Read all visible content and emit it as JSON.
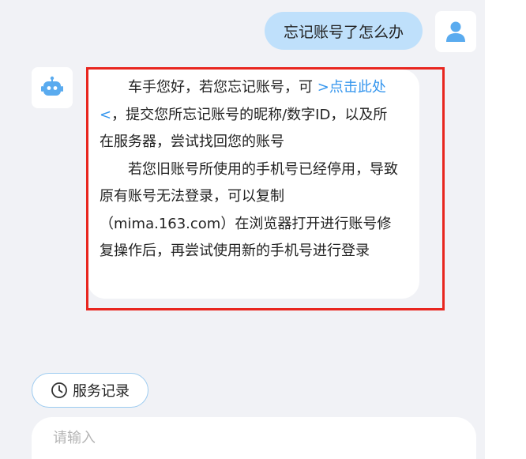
{
  "colors": {
    "user_bubble": "#bfe0fb",
    "link": "#3596ee",
    "highlight": "#e8261f",
    "chat_bg": "#f1f2f6",
    "accent_icon": "#5aabef"
  },
  "user_message": {
    "text": "忘记账号了怎么办",
    "avatar_icon": "person-icon"
  },
  "bot_message": {
    "avatar_icon": "robot-icon",
    "para1_prefix": "车手您好，若您忘记账号，可 ",
    "para1_link": ">点击此处<",
    "para1_suffix": "，提交您所忘记账号的昵称/数字ID，以及所在服务器，尝试找回您的账号",
    "para2": "若您旧账号所使用的手机号已经停用，导致原有账号无法登录，可以复制（mima.163.com）在浏览器打开进行账号修复操作后，再尝试使用新的手机号进行登录"
  },
  "service_record": {
    "label": "服务记录",
    "icon": "clock-icon"
  },
  "input": {
    "placeholder": "请输入",
    "value": ""
  }
}
